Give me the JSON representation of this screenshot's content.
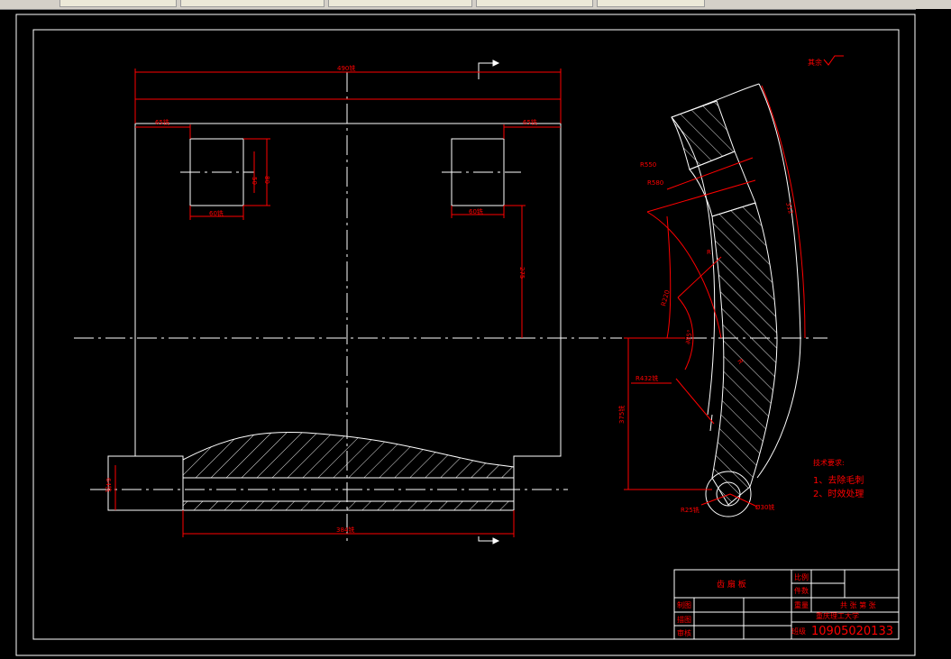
{
  "dimensions": {
    "top_width": "490铣",
    "left_offset": "65铣",
    "right_offset": "65铣",
    "slot_left_width": "60铣",
    "slot_right_width": "60铣",
    "slot_height_outer": "80",
    "slot_height_inner": "50",
    "vertical_to_axis": "275",
    "shaft_dia": "64铣",
    "bottom_length": "384铣",
    "r550": "R550",
    "r580": "R580",
    "len_right": "312",
    "r_small": "R",
    "r220": "R220",
    "angle": "∂85°",
    "r_inner": "R",
    "r432": "R432铣",
    "height_375": "375铣",
    "r25": "R25铣",
    "d30": "Ø30铣"
  },
  "roughness": {
    "label": "其余"
  },
  "tech_requirements": {
    "title": "技术要求:",
    "items": [
      "1、去除毛刺",
      "2、时效处理"
    ]
  },
  "title_block": {
    "drawing_name": "齿 扇 板",
    "scale_label": "比例",
    "count_label": "件数",
    "weight_label": "重量",
    "drawn_label": "制图",
    "designed_label": "描图",
    "checked_label": "审核",
    "sheet_label": "共 张 第 张",
    "school": "重庆理工大学",
    "student_id_label": "班级",
    "student_id": "10905020133"
  },
  "colors": {
    "background": "#000000",
    "outline": "#ffffff",
    "dimension": "#ff0000",
    "title_text": "#ff0000"
  }
}
